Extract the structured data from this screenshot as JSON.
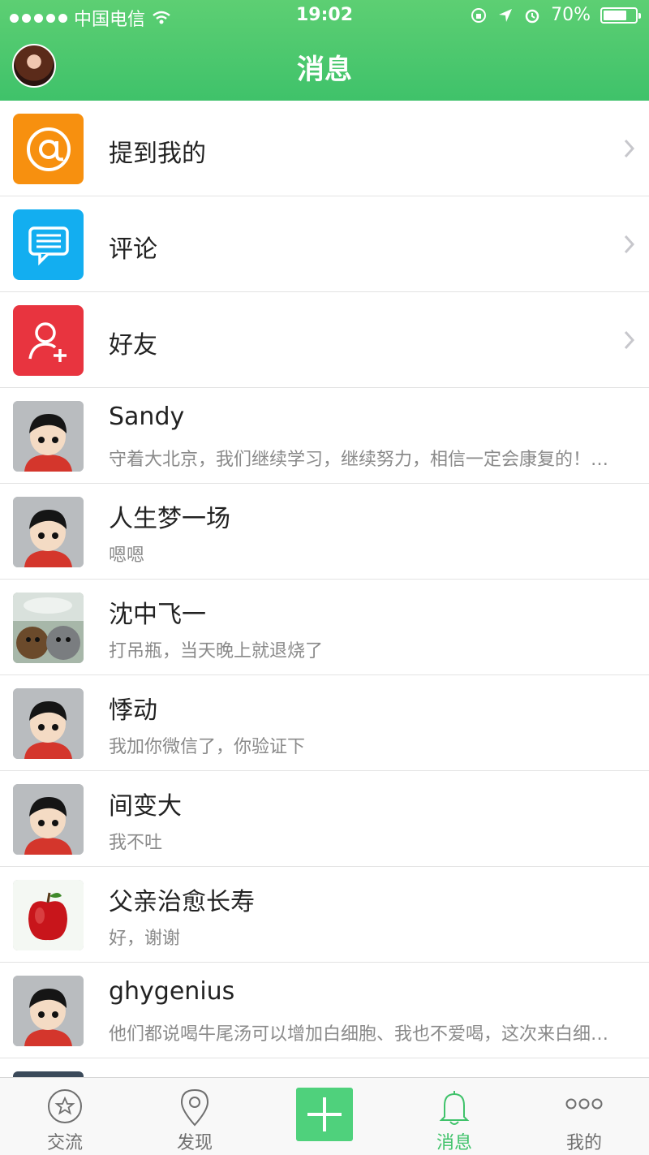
{
  "status_bar": {
    "carrier": "中国电信",
    "time": "19:02",
    "battery": "70%"
  },
  "nav": {
    "title": "消息"
  },
  "menu_rows": [
    {
      "label": "提到我的",
      "icon": "at-icon",
      "color": "#f7900f"
    },
    {
      "label": "评论",
      "icon": "comment-icon",
      "color": "#13aef0"
    },
    {
      "label": "好友",
      "icon": "add-friend-icon",
      "color": "#e8343f"
    }
  ],
  "conversations": [
    {
      "name": "Sandy",
      "message": "守着大北京，我们继续学习，继续努力，相信一定会康复的！…",
      "avatar": "default-cartoon-avatar"
    },
    {
      "name": "人生梦一场",
      "message": "嗯嗯",
      "avatar": "default-cartoon-avatar"
    },
    {
      "name": "沈中飞一",
      "message": "打吊瓶，当天晚上就退烧了",
      "avatar": "dogs-photo-avatar"
    },
    {
      "name": "悸动",
      "message": "我加你微信了，你验证下",
      "avatar": "default-cartoon-avatar"
    },
    {
      "name": "间变大",
      "message": "我不吐",
      "avatar": "default-cartoon-avatar"
    },
    {
      "name": "父亲治愈长寿",
      "message": "好，谢谢",
      "avatar": "apple-avatar"
    },
    {
      "name": "ghygenius",
      "message": "他们都说喝牛尾汤可以增加白细胞、我也不爱喝，这次来白细…",
      "avatar": "default-cartoon-avatar"
    }
  ],
  "tabs": [
    {
      "label": "交流",
      "icon": "star-circle-icon",
      "active": false
    },
    {
      "label": "发现",
      "icon": "location-pin-icon",
      "active": false
    },
    {
      "label": "",
      "icon": "plus-icon",
      "active": false
    },
    {
      "label": "消息",
      "icon": "bell-icon",
      "active": true
    },
    {
      "label": "我的",
      "icon": "more-dots-icon",
      "active": false
    }
  ],
  "colors": {
    "brand_green": "#3fc26a",
    "divider": "#e3e3e3"
  }
}
